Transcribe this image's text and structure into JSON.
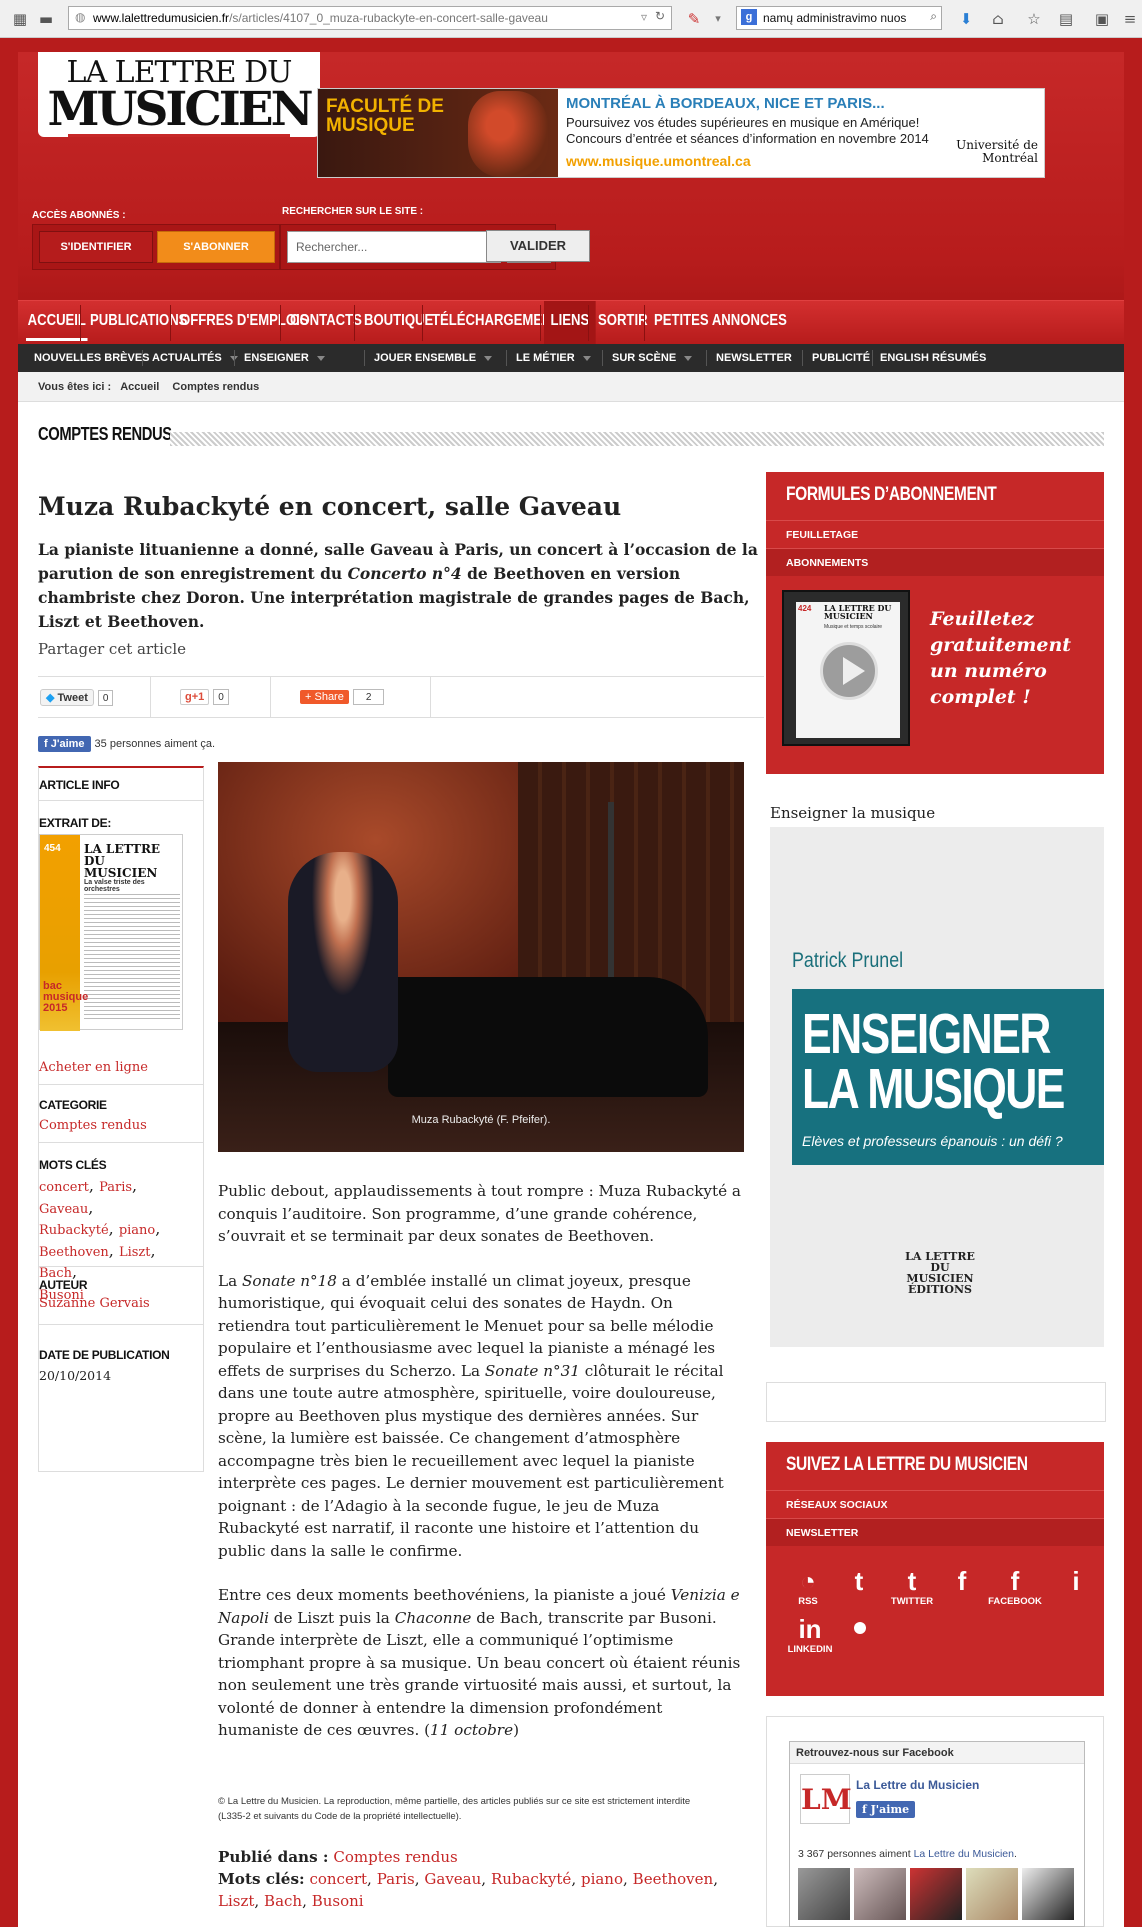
{
  "browser": {
    "url_domain": "www.lalettredumusicien.fr",
    "url_path": "/s/articles/4107_0_muza-rubackyte-en-concert-salle-gaveau",
    "search_text": "namų administravimo nuos",
    "search_engine_icon": "g-icon"
  },
  "site": {
    "logo_line1": "LA LETTRE DU",
    "logo_line2": "MUSICIEN",
    "banner": {
      "left_title": "FACULTÉ DE MUSIQUE",
      "headline": "MONTRÉAL À BORDEAUX, NICE ET PARIS...",
      "text1": "Poursuivez vos études supérieures en musique en Amérique!",
      "text2": "Concours d’entrée et séances d’information en novembre 2014",
      "link": "www.musique.umontreal.ca",
      "university": "Université de Montréal"
    },
    "acces_label": "ACCÈS ABONNÉS :",
    "identify_button": "S'IDENTIFIER",
    "subscribe_button": "S'ABONNER",
    "search_label": "RECHERCHER SUR LE SITE :",
    "search_placeholder": "Rechercher...",
    "search_button": "VALIDER"
  },
  "main_nav": [
    "ACCUEIL",
    "PUBLICATIONS",
    "OFFRES D'EMPLOIS",
    "CONTACTS",
    "BOUTIQUE",
    "TÉLÉCHARGEMENTS",
    "LIENS",
    "SORTIR",
    "PETITES ANNONCES"
  ],
  "sub_nav": [
    "NOUVELLES BRÈVES",
    "ACTUALITÉS",
    "ENSEIGNER",
    "JOUER ENSEMBLE",
    "LE MÉTIER",
    "SUR SCÈNE",
    "NEWSLETTER",
    "PUBLICITÉ",
    "ENGLISH RÉSUMÉS"
  ],
  "breadcrumb": {
    "label": "Vous êtes ici :",
    "home": "Accueil",
    "current": "Comptes rendus"
  },
  "section_title": "COMPTES RENDUS",
  "article": {
    "title": "Muza Rubackyté en concert, salle Gaveau",
    "lead_1": "La pianiste lituanienne a donné, salle Gaveau à Paris, un concert à l’occasion de la parution de son enregistrement du ",
    "lead_em": "Concerto n°4",
    "lead_2": " de Beethoven en version chambriste chez Doron. Une interprétation magistrale de grandes pages de Bach, Liszt et Beethoven.",
    "share_label": "Partager cet article",
    "tweet": "Tweet",
    "tweet_count": "0",
    "gplus": "+1",
    "gplus_count": "0",
    "share": "Share",
    "share_count": "2",
    "fb_like": "J'aime",
    "fb_like_text": "35 personnes aiment ça.",
    "photo_caption": "Muza Rubackyté (F. Pfeifer).",
    "p1": "Public debout, applaudissements à tout rompre : Muza Rubackyté a conquis l’auditoire. Son programme, d’une grande cohérence, s’ouvrait et se terminait par deux sonates de Beethoven.",
    "p2a": "La ",
    "p2em1": "Sonate n°18",
    "p2b": " a d’emblée installé un climat joyeux, presque humoristique, qui évoquait celui des sonates de Haydn. On retiendra tout particulièrement le Menuet pour sa belle mélodie populaire et l’enthousiasme avec lequel la pianiste a ménagé les effets de surprises du Scherzo. La ",
    "p2em2": "Sonate n°31",
    "p2c": " clôturait le récital dans une toute autre atmosphère, spirituelle, voire douloureuse, propre au Beethoven plus mystique des dernières années. Sur scène, la lumière est baissée. Ce changement d’atmosphère accompagne très bien le recueillement avec lequel la pianiste interprète ces pages. Le dernier mouvement est particulièrement poignant : de l’Adagio à la seconde fugue, le jeu de Muza Rubackyté est narratif, il raconte une histoire et l’attention du public dans la salle le confirme.",
    "p3a": "Entre ces deux moments beethovéniens, la pianiste a joué ",
    "p3em1": "Venizia e Napoli",
    "p3b": " de Liszt puis la ",
    "p3em2": "Chaconne",
    "p3c": " de Bach, transcrite par Busoni. Grande interprète de Liszt, elle a communiqué l’optimisme triomphant propre à sa musique. Un beau concert où étaient réunis non seulement une très grande virtuosité mais aussi, et surtout, la volonté de donner à entendre la dimension profondément humaniste de ces  œuvres.  (",
    "p3em3": "11 octobre",
    "p3d": ")",
    "copyright": "© La Lettre du Musicien. La reproduction, même partielle, des articles publiés sur ce site est strictement interdite (L335-2 et suivants du Code de la propriété intellectuelle).",
    "published_label": "Publié dans :",
    "published_value": "Comptes rendus",
    "keywords_label": "Mots clés:",
    "keywords": [
      "concert",
      "Paris",
      "Gaveau",
      "Rubackyté",
      "piano",
      "Beethoven",
      "Liszt",
      "Bach",
      "Busoni"
    ]
  },
  "info": {
    "header": "ARTICLE INFO",
    "extract_label": "EXTRAIT DE:",
    "mag_title": "LA LETTRE DU MUSICIEN",
    "mag_issue": "454",
    "mag_headline": "La valse triste des orchestres",
    "mag_badge": "bac musique 2015",
    "buy": "Acheter en ligne",
    "category_label": "CATEGORIE",
    "category": "Comptes rendus",
    "tags_label": "MOTS CLÉS",
    "author_label": "AUTEUR",
    "author": "Suzanne Gervais",
    "date_label": "DATE DE PUBLICATION",
    "date": "20/10/2014"
  },
  "sidebar": {
    "formules_title": "FORMULES D’ABONNEMENT",
    "feuilletage": "FEUILLETAGE",
    "abonnements": "ABONNEMENTS",
    "thumb_issue": "424",
    "thumb_title": "LA LETTRE DU MUSICIEN",
    "thumb_headline": "Musique et temps scolaire",
    "promo": "Feuilletez gratuitement un numéro complet !",
    "ens_label": "Enseigner la musique",
    "ens_author": "Patrick Prunel",
    "ens_title": "ENSEIGNER LA MUSIQUE",
    "ens_subtitle": "Elèves et professeurs épanouis : un défi ?",
    "ens_publisher": "LA LETTRE DU MUSICIEN ÉDITIONS",
    "suivez_title": "SUIVEZ LA LETTRE DU MUSICIEN",
    "reseaux": "RÉSEAUX SOCIAUX",
    "newsletter": "NEWSLETTER",
    "social": [
      "RSS",
      "TWITTER",
      "FACEBOOK",
      "LINKEDIN"
    ],
    "fb_box_title": "Retrouvez-nous sur Facebook",
    "fb_page": "La Lettre du Musicien",
    "fb_like": "J'aime",
    "fb_fans_prefix": "3 367 personnes aiment ",
    "fb_fans_link": "La Lettre du Musicien",
    "fb_fans_suffix": "."
  },
  "colors": {
    "brand_red": "#c62828",
    "orange": "#f28c1a",
    "teal": "#17717f"
  }
}
